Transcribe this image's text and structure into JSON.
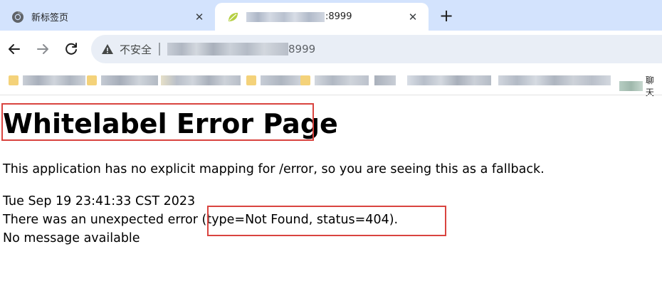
{
  "browser": {
    "tabs": [
      {
        "title": "新标签页",
        "favicon": "chrome-icon",
        "active": false
      },
      {
        "title_visible": ":8999",
        "favicon": "spring-leaf-icon",
        "active": true
      }
    ],
    "new_tab_label": "+",
    "close_label": "✕",
    "address_bar": {
      "security_label": "不安全",
      "url_visible_suffix": "8999"
    },
    "bookmarks_bar": {
      "last_item_label": "聊天"
    }
  },
  "page": {
    "title": "Whitelabel Error Page",
    "message": "This application has no explicit mapping for /error, so you are seeing this as a fallback.",
    "timestamp": "Tue Sep 19 23:41:33 CST 2023",
    "error_line": "There was an unexpected error (type=Not Found, status=404).",
    "detail": "No message available"
  },
  "colors": {
    "tabstrip_bg": "#d3e3fd",
    "omnibox_bg": "#e9eef6",
    "highlight_box": "#d9443f"
  }
}
